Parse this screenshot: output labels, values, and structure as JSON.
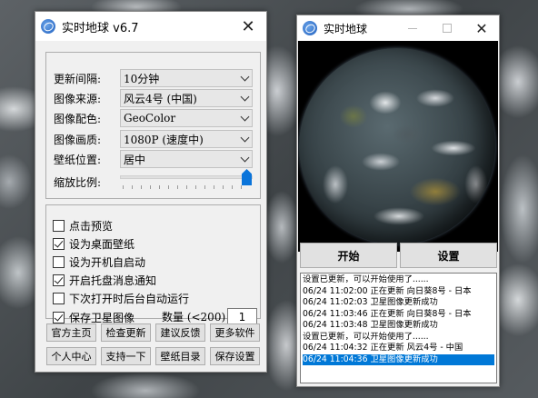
{
  "left_window": {
    "title": "实时地球 v6.7",
    "settings": [
      {
        "label": "更新间隔:",
        "value": "10分钟"
      },
      {
        "label": "图像来源:",
        "value": "风云4号 (中国)"
      },
      {
        "label": "图像配色:",
        "value": "GeoColor"
      },
      {
        "label": "图像画质:",
        "value": "1080P (速度中)"
      },
      {
        "label": "壁纸位置:",
        "value": "居中"
      }
    ],
    "scale_label": "缩放比例:",
    "scale_level": 1.0,
    "options": [
      {
        "label": "点击预览",
        "checked": false
      },
      {
        "label": "设为桌面壁纸",
        "checked": true
      },
      {
        "label": "设为开机自启动",
        "checked": false
      },
      {
        "label": "开启托盘消息通知",
        "checked": true
      },
      {
        "label": "下次打开时后台自动运行",
        "checked": false
      },
      {
        "label": "保存卫星图像",
        "checked": true
      }
    ],
    "quantity_label": "数量 (<200)",
    "quantity_value": "1",
    "buttons": [
      "官方主页",
      "检查更新",
      "建议反馈",
      "更多软件",
      "个人中心",
      "支持一下",
      "壁纸目录",
      "保存设置"
    ]
  },
  "right_window": {
    "title": "实时地球",
    "start_label": "开始",
    "settings_label": "设置",
    "log": [
      "设置已更新，可以开始使用了......",
      "06/24 11:02:00 正在更新 向日葵8号 - 日本",
      "06/24 11:02:03 卫星图像更新成功",
      "06/24 11:03:46 正在更新 向日葵8号 - 日本",
      "06/24 11:03:48 卫星图像更新成功",
      "设置已更新，可以开始使用了......",
      "06/24 11:04:32 正在更新 风云4号 - 中国",
      "06/24 11:04:36 卫星图像更新成功"
    ],
    "selected_log_index": 7
  },
  "colors": {
    "accent": "#0078d7",
    "slider_thumb": "#0a74da"
  }
}
